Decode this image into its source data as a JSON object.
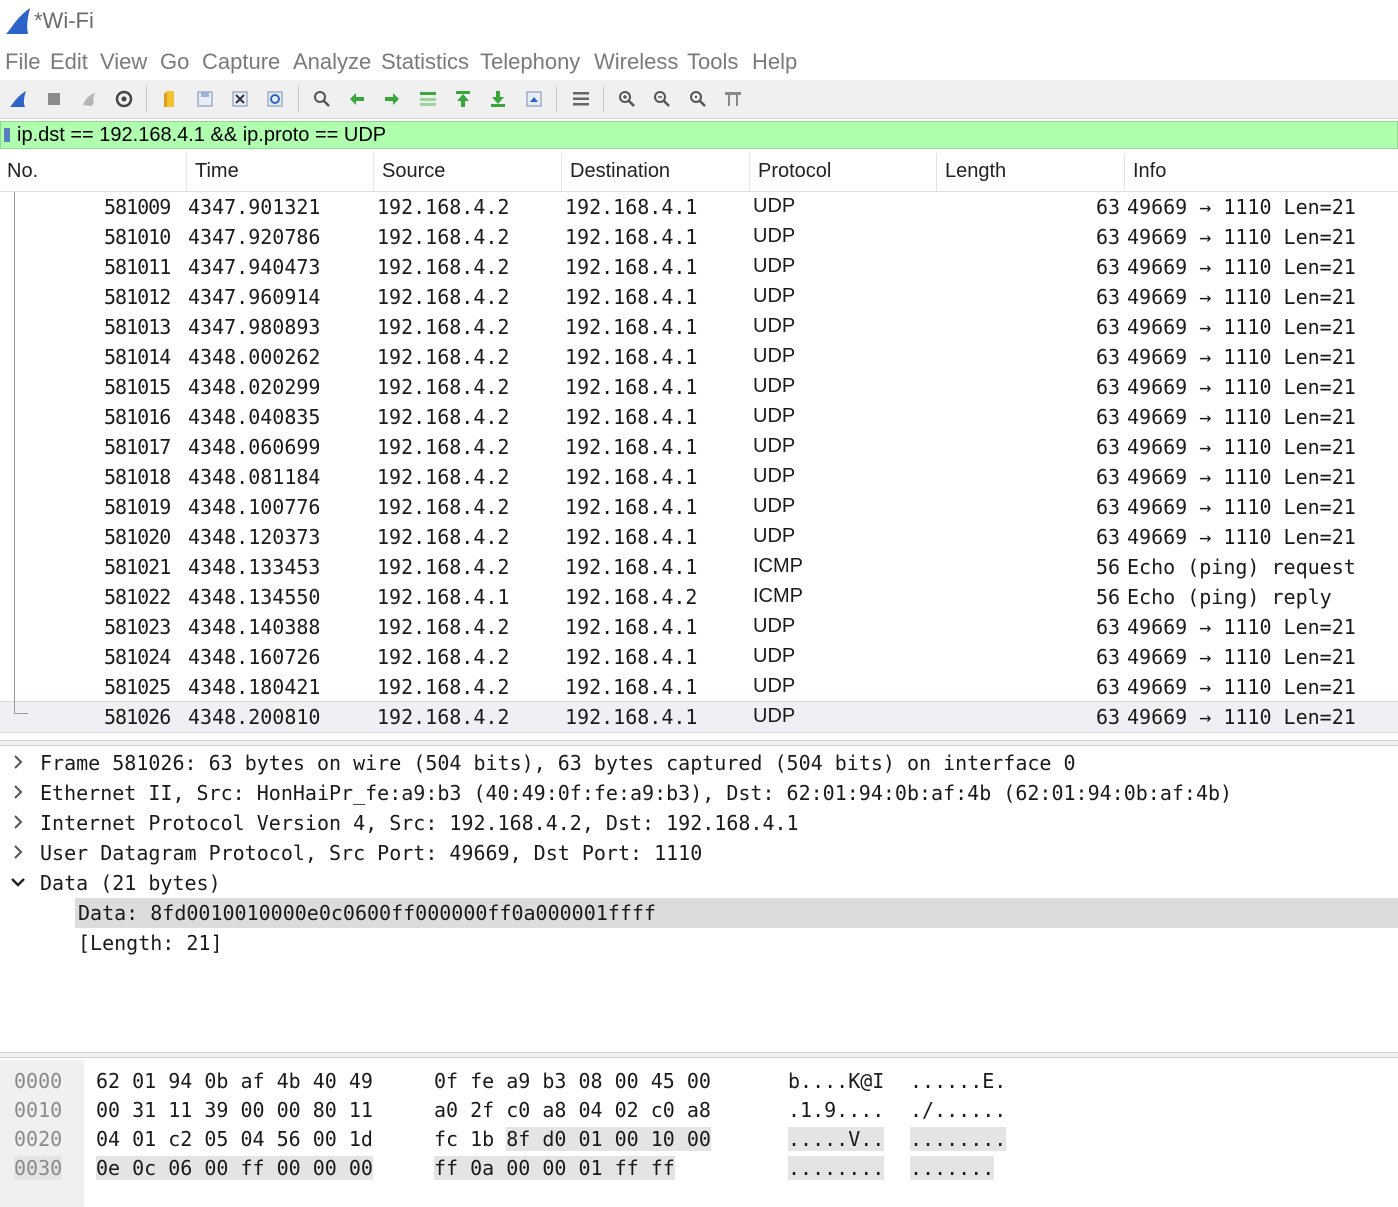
{
  "window": {
    "title": "*Wi-Fi"
  },
  "menu": [
    "File",
    "Edit",
    "View",
    "Go",
    "Capture",
    "Analyze",
    "Statistics",
    "Telephony",
    "Wireless",
    "Tools",
    "Help"
  ],
  "toolbar_icons": [
    "shark-fin-start-icon",
    "stop-icon",
    "restart-icon",
    "options-gear-icon",
    "open-folder-icon",
    "save-file-icon",
    "close-file-icon",
    "reload-icon",
    "find-icon",
    "go-back-icon",
    "go-forward-icon",
    "go-to-packet-icon",
    "first-packet-icon",
    "last-packet-icon",
    "autoscroll-icon",
    "colorize-icon",
    "zoom-in-icon",
    "zoom-out-icon",
    "normal-size-icon",
    "resize-columns-icon"
  ],
  "filter": {
    "value": "ip.dst == 192.168.4.1 && ip.proto == UDP"
  },
  "columns": [
    "No.",
    "Time",
    "Source",
    "Destination",
    "Protocol",
    "Length",
    "Info"
  ],
  "packets": [
    {
      "no": "581009",
      "time": "4347.901321",
      "src": "192.168.4.2",
      "dst": "192.168.4.1",
      "proto": "UDP",
      "len": "63",
      "info": "49669 → 1110 Len=21"
    },
    {
      "no": "581010",
      "time": "4347.920786",
      "src": "192.168.4.2",
      "dst": "192.168.4.1",
      "proto": "UDP",
      "len": "63",
      "info": "49669 → 1110 Len=21"
    },
    {
      "no": "581011",
      "time": "4347.940473",
      "src": "192.168.4.2",
      "dst": "192.168.4.1",
      "proto": "UDP",
      "len": "63",
      "info": "49669 → 1110 Len=21"
    },
    {
      "no": "581012",
      "time": "4347.960914",
      "src": "192.168.4.2",
      "dst": "192.168.4.1",
      "proto": "UDP",
      "len": "63",
      "info": "49669 → 1110 Len=21"
    },
    {
      "no": "581013",
      "time": "4347.980893",
      "src": "192.168.4.2",
      "dst": "192.168.4.1",
      "proto": "UDP",
      "len": "63",
      "info": "49669 → 1110 Len=21"
    },
    {
      "no": "581014",
      "time": "4348.000262",
      "src": "192.168.4.2",
      "dst": "192.168.4.1",
      "proto": "UDP",
      "len": "63",
      "info": "49669 → 1110 Len=21"
    },
    {
      "no": "581015",
      "time": "4348.020299",
      "src": "192.168.4.2",
      "dst": "192.168.4.1",
      "proto": "UDP",
      "len": "63",
      "info": "49669 → 1110 Len=21"
    },
    {
      "no": "581016",
      "time": "4348.040835",
      "src": "192.168.4.2",
      "dst": "192.168.4.1",
      "proto": "UDP",
      "len": "63",
      "info": "49669 → 1110 Len=21"
    },
    {
      "no": "581017",
      "time": "4348.060699",
      "src": "192.168.4.2",
      "dst": "192.168.4.1",
      "proto": "UDP",
      "len": "63",
      "info": "49669 → 1110 Len=21"
    },
    {
      "no": "581018",
      "time": "4348.081184",
      "src": "192.168.4.2",
      "dst": "192.168.4.1",
      "proto": "UDP",
      "len": "63",
      "info": "49669 → 1110 Len=21"
    },
    {
      "no": "581019",
      "time": "4348.100776",
      "src": "192.168.4.2",
      "dst": "192.168.4.1",
      "proto": "UDP",
      "len": "63",
      "info": "49669 → 1110 Len=21"
    },
    {
      "no": "581020",
      "time": "4348.120373",
      "src": "192.168.4.2",
      "dst": "192.168.4.1",
      "proto": "UDP",
      "len": "63",
      "info": "49669 → 1110 Len=21"
    },
    {
      "no": "581021",
      "time": "4348.133453",
      "src": "192.168.4.2",
      "dst": "192.168.4.1",
      "proto": "ICMP",
      "len": "56",
      "info": "Echo (ping) request"
    },
    {
      "no": "581022",
      "time": "4348.134550",
      "src": "192.168.4.1",
      "dst": "192.168.4.2",
      "proto": "ICMP",
      "len": "56",
      "info": "Echo (ping) reply"
    },
    {
      "no": "581023",
      "time": "4348.140388",
      "src": "192.168.4.2",
      "dst": "192.168.4.1",
      "proto": "UDP",
      "len": "63",
      "info": "49669 → 1110 Len=21"
    },
    {
      "no": "581024",
      "time": "4348.160726",
      "src": "192.168.4.2",
      "dst": "192.168.4.1",
      "proto": "UDP",
      "len": "63",
      "info": "49669 → 1110 Len=21"
    },
    {
      "no": "581025",
      "time": "4348.180421",
      "src": "192.168.4.2",
      "dst": "192.168.4.1",
      "proto": "UDP",
      "len": "63",
      "info": "49669 → 1110 Len=21"
    },
    {
      "no": "581026",
      "time": "4348.200810",
      "src": "192.168.4.2",
      "dst": "192.168.4.1",
      "proto": "UDP",
      "len": "63",
      "info": "49669 → 1110 Len=21"
    }
  ],
  "selected_packet": "581026",
  "details": [
    {
      "text": "Frame 581026: 63 bytes on wire (504 bits), 63 bytes captured (504 bits) on interface 0",
      "expanded": false
    },
    {
      "text": "Ethernet II, Src: HonHaiPr_fe:a9:b3 (40:49:0f:fe:a9:b3), Dst: 62:01:94:0b:af:4b (62:01:94:0b:af:4b)",
      "expanded": false
    },
    {
      "text": "Internet Protocol Version 4, Src: 192.168.4.2, Dst: 192.168.4.1",
      "expanded": false
    },
    {
      "text": "User Datagram Protocol, Src Port: 49669, Dst Port: 1110",
      "expanded": false
    },
    {
      "text": "Data (21 bytes)",
      "expanded": true
    }
  ],
  "data_children": [
    "Data: 8fd0010010000e0c0600ff000000ff0a000001ffff",
    "[Length: 21]"
  ],
  "hex_rows": [
    {
      "offset": "0000",
      "b1": "62 01 94 0b af 4b 40 49",
      "b2": "0f fe a9 b3 08 00 45 00",
      "a1": "b....K@I",
      "a2": "......E."
    },
    {
      "offset": "0010",
      "b1": "00 31 11 39 00 00 80 11",
      "b2": "a0 2f c0 a8 04 02 c0 a8",
      "a1": ".1.9....",
      "a2": "./......"
    },
    {
      "offset": "0020",
      "b1": "04 01 c2 05 04 56 00 1d",
      "b2": "fc 1b 8f d0 01 00 10 00",
      "a1": ".....V..",
      "a2": "........"
    },
    {
      "offset": "0030",
      "b1": "0e 0c 06 00 ff 00 00 00",
      "b2": "ff 0a 00 00 01 ff ff",
      "a1": "........",
      "a2": "......."
    }
  ],
  "colors": {
    "filter_valid_bg": "#afffaf",
    "selected_row_bg": "#eef0f4",
    "shark_blue": "#2b63c8"
  }
}
